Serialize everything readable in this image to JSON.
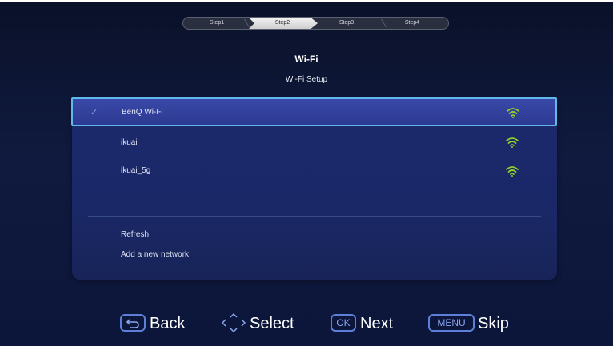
{
  "steps": [
    "Step1",
    "Step2",
    "Step3",
    "Step4"
  ],
  "active_step": 2,
  "header": {
    "title": "Wi-Fi",
    "subtitle": "Wi-Fi Setup"
  },
  "networks": [
    {
      "name": "BenQ Wi-Fi",
      "selected": true,
      "signal_icon": "wifi-signal-icon"
    },
    {
      "name": "ikuai",
      "selected": false,
      "signal_icon": "wifi-signal-icon"
    },
    {
      "name": "ikuai_5g",
      "selected": false,
      "signal_icon": "wifi-signal-icon"
    }
  ],
  "actions": [
    "Refresh",
    "Add a new network"
  ],
  "footer": {
    "back_label": "Back",
    "select_label": "Select",
    "ok_key": "OK",
    "next_label": "Next",
    "menu_key": "MENU",
    "skip_label": "Skip"
  },
  "colors": {
    "background": "#0f1a3e",
    "panel": "#1c2a6c",
    "selected_row": "#3a48a8",
    "selected_border": "#5fb9ee",
    "wifi_signal": "#8ccf2c",
    "key_outline": "#5d7fd7"
  }
}
